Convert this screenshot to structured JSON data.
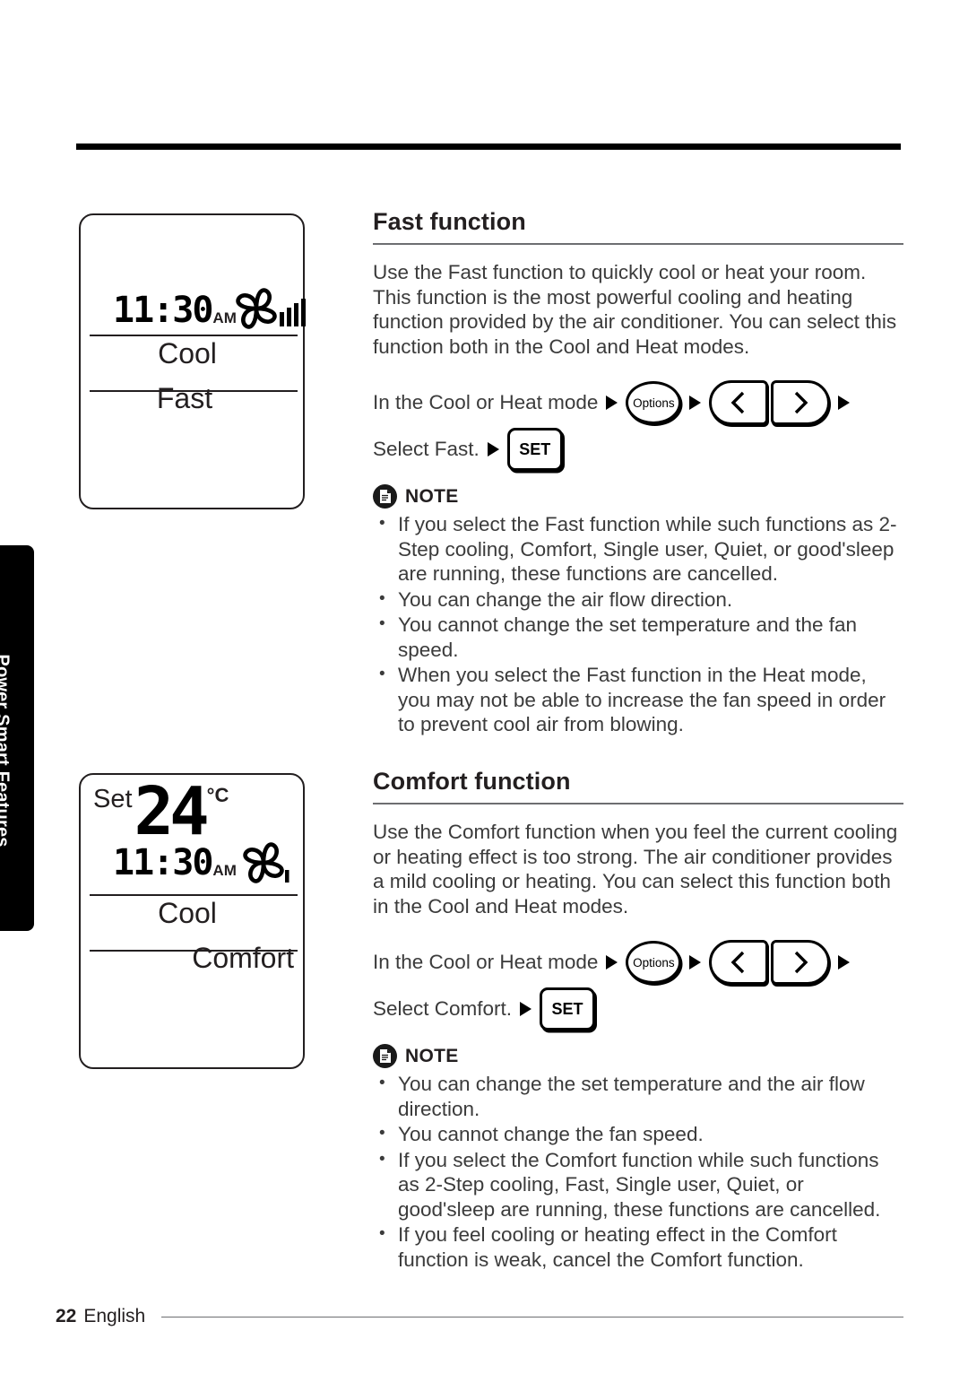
{
  "sidebar": {
    "tab_label": "Power Smart Features"
  },
  "displays": [
    {
      "id": "fast",
      "set_label": "",
      "temperature": "",
      "unit": "",
      "time": "11:30",
      "meridiem": "AM",
      "mode": "Cool",
      "function": "Fast",
      "fan_icon": "fan-pinwheel-icon",
      "fan_bars": 4
    },
    {
      "id": "comfort",
      "set_label": "Set",
      "temperature": "24",
      "unit": "°C",
      "time": "11:30",
      "meridiem": "AM",
      "mode": "Cool",
      "function": "Comfort",
      "fan_icon": "fan-pinwheel-icon",
      "fan_bars": 1
    }
  ],
  "sections": [
    {
      "id": "fast",
      "heading": "Fast function",
      "body": "Use the Fast function to quickly cool or heat your room. This function is the most powerful cooling and heating function provided by the air conditioner. You can select this function both in the Cool and Heat modes.",
      "steps": {
        "line1_text": "In the Cool or Heat mode",
        "options_label": "Options",
        "line2_text": "Select Fast.",
        "set_label": "SET"
      },
      "note_title": "NOTE",
      "notes": [
        "If you select the Fast function while such functions as 2-Step cooling, Comfort, Single user, Quiet, or good'sleep are running, these functions are cancelled.",
        "You can change the air flow direction.",
        "You cannot change the set temperature and the fan speed.",
        "When you select the Fast function in the Heat mode, you may not be able to increase the fan speed in order to prevent cool air from blowing."
      ]
    },
    {
      "id": "comfort",
      "heading": "Comfort function",
      "body": "Use the Comfort function when you feel the current cooling or heating effect is too strong. The air conditioner provides a mild cooling or heating. You can select this function both in the Cool and Heat modes.",
      "steps": {
        "line1_text": "In the Cool or Heat mode",
        "options_label": "Options",
        "line2_text": "Select Comfort.",
        "set_label": "SET"
      },
      "note_title": "NOTE",
      "notes": [
        "You can change the set temperature and the air flow direction.",
        "You cannot change the fan speed.",
        "If you select the Comfort function while such functions as 2-Step cooling, Fast, Single user, Quiet, or good'sleep are running, these functions are cancelled.",
        "If you feel cooling or heating effect in the Comfort function is weak, cancel the Comfort function."
      ]
    }
  ],
  "footer": {
    "page_number": "22",
    "language": "English"
  },
  "colors": {
    "text": "#231f20",
    "body_text": "#3b3b3b",
    "rule": "#6d6e71",
    "tab_background": "#000000",
    "tab_text": "#ffffff"
  }
}
